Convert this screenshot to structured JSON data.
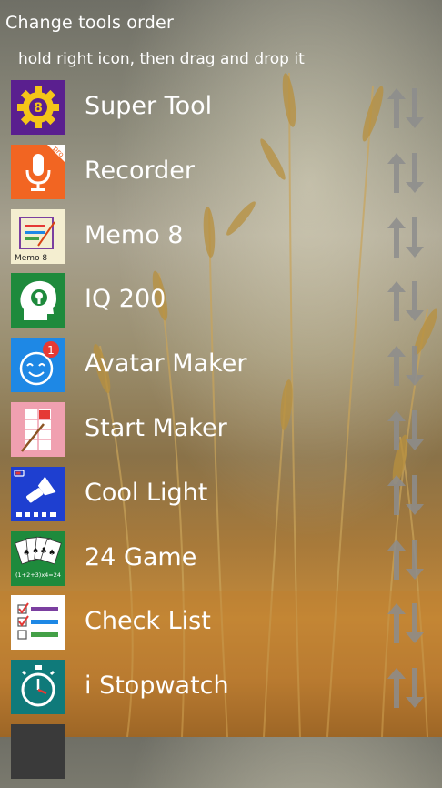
{
  "header": {
    "title": "Change tools order",
    "hint": "hold right icon, then drag and drop it"
  },
  "tools": [
    {
      "label": "Super Tool",
      "icon": "super-tool-icon",
      "color": "#5a1f8f"
    },
    {
      "label": "Recorder",
      "icon": "microphone-icon",
      "color": "#f26522",
      "badge_text": "pro"
    },
    {
      "label": "Memo 8",
      "icon": "memo-icon",
      "color": "#f4eed0",
      "tile_text": "Memo 8"
    },
    {
      "label": "IQ 200",
      "icon": "brain-head-icon",
      "color": "#1e8a3c"
    },
    {
      "label": "Avatar Maker",
      "icon": "smiley-icon",
      "color": "#1e88e5",
      "badge_count": "1"
    },
    {
      "label": "Start Maker",
      "icon": "grid-paint-icon",
      "color": "#f0a0b0"
    },
    {
      "label": "Cool Light",
      "icon": "flashlight-icon",
      "color": "#1e3fd0"
    },
    {
      "label": "24 Game",
      "icon": "playing-cards-icon",
      "color": "#1e8a3c",
      "tile_text": "(1+2+3)x4=24"
    },
    {
      "label": "Check List",
      "icon": "checklist-icon",
      "color": "#ffffff"
    },
    {
      "label": "i Stopwatch",
      "icon": "stopwatch-icon",
      "color": "#0f7a7a"
    }
  ],
  "drag_icon": "reorder-arrows-icon"
}
